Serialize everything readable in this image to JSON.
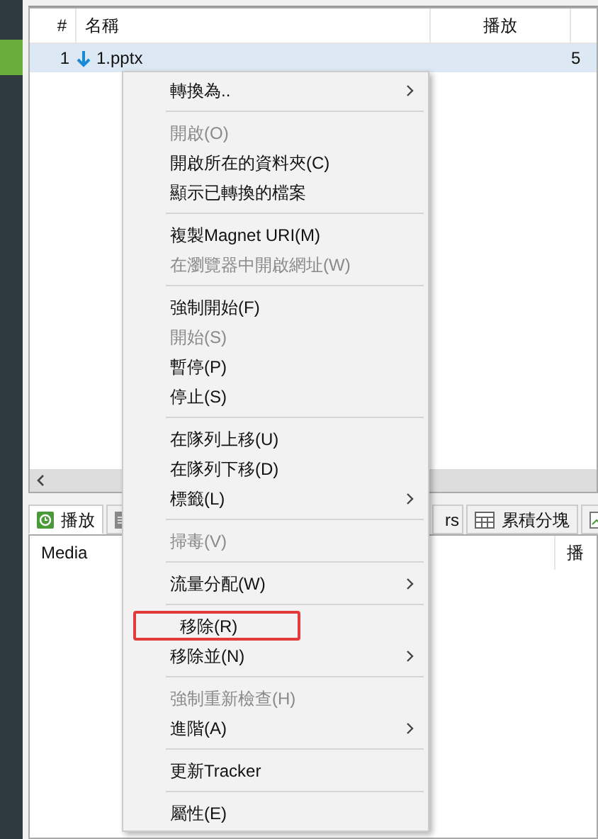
{
  "table": {
    "columns": [
      "#",
      "名稱",
      "播放"
    ],
    "rows": [
      {
        "number": "1",
        "name": "1.pptx",
        "column_4": "5",
        "selected": true
      }
    ]
  },
  "bottom_tabs": [
    {
      "label": "播放",
      "kind": "clock",
      "selected": true
    },
    {
      "kind": "list",
      "selected": false
    },
    {
      "label": "rs",
      "kind": "none",
      "selected": false
    },
    {
      "label": "累積分塊",
      "kind": "grid",
      "selected": false
    },
    {
      "kind": "chart",
      "selected": false
    }
  ],
  "bottom_panel": {
    "columns": [
      "Media",
      "播"
    ]
  },
  "context_menu": [
    {
      "kind": "item",
      "label": "轉換為..",
      "disabled": false,
      "submenu": true,
      "highlighted": false
    },
    {
      "kind": "separator"
    },
    {
      "kind": "item",
      "label": "開啟(O)",
      "disabled": true,
      "submenu": false,
      "highlighted": false
    },
    {
      "kind": "item",
      "label": "開啟所在的資料夾(C)",
      "disabled": false,
      "submenu": false,
      "highlighted": false
    },
    {
      "kind": "item",
      "label": "顯示已轉換的檔案",
      "disabled": false,
      "submenu": false,
      "highlighted": false
    },
    {
      "kind": "separator"
    },
    {
      "kind": "item",
      "label": "複製Magnet URI(M)",
      "disabled": false,
      "submenu": false,
      "highlighted": false
    },
    {
      "kind": "item",
      "label": "在瀏覽器中開啟網址(W)",
      "disabled": true,
      "submenu": false,
      "highlighted": false
    },
    {
      "kind": "separator"
    },
    {
      "kind": "item",
      "label": "強制開始(F)",
      "disabled": false,
      "submenu": false,
      "highlighted": false
    },
    {
      "kind": "item",
      "label": "開始(S)",
      "disabled": true,
      "submenu": false,
      "highlighted": false
    },
    {
      "kind": "item",
      "label": "暫停(P)",
      "disabled": false,
      "submenu": false,
      "highlighted": false
    },
    {
      "kind": "item",
      "label": "停止(S)",
      "disabled": false,
      "submenu": false,
      "highlighted": false
    },
    {
      "kind": "separator"
    },
    {
      "kind": "item",
      "label": "在隊列上移(U)",
      "disabled": false,
      "submenu": false,
      "highlighted": false
    },
    {
      "kind": "item",
      "label": "在隊列下移(D)",
      "disabled": false,
      "submenu": false,
      "highlighted": false
    },
    {
      "kind": "item",
      "label": "標籤(L)",
      "disabled": false,
      "submenu": true,
      "highlighted": false
    },
    {
      "kind": "separator"
    },
    {
      "kind": "item",
      "label": "掃毒(V)",
      "disabled": true,
      "submenu": false,
      "highlighted": false
    },
    {
      "kind": "separator"
    },
    {
      "kind": "item",
      "label": "流量分配(W)",
      "disabled": false,
      "submenu": true,
      "highlighted": false
    },
    {
      "kind": "separator"
    },
    {
      "kind": "item",
      "label": "移除(R)",
      "disabled": false,
      "submenu": false,
      "highlighted": true
    },
    {
      "kind": "item",
      "label": "移除並(N)",
      "disabled": false,
      "submenu": true,
      "highlighted": false
    },
    {
      "kind": "separator"
    },
    {
      "kind": "item",
      "label": "強制重新檢查(H)",
      "disabled": true,
      "submenu": false,
      "highlighted": false
    },
    {
      "kind": "item",
      "label": "進階(A)",
      "disabled": false,
      "submenu": true,
      "highlighted": false
    },
    {
      "kind": "separator"
    },
    {
      "kind": "item",
      "label": "更新Tracker",
      "disabled": false,
      "submenu": false,
      "highlighted": false
    },
    {
      "kind": "separator"
    },
    {
      "kind": "item",
      "label": "屬性(E)",
      "disabled": false,
      "submenu": false,
      "highlighted": false
    }
  ]
}
